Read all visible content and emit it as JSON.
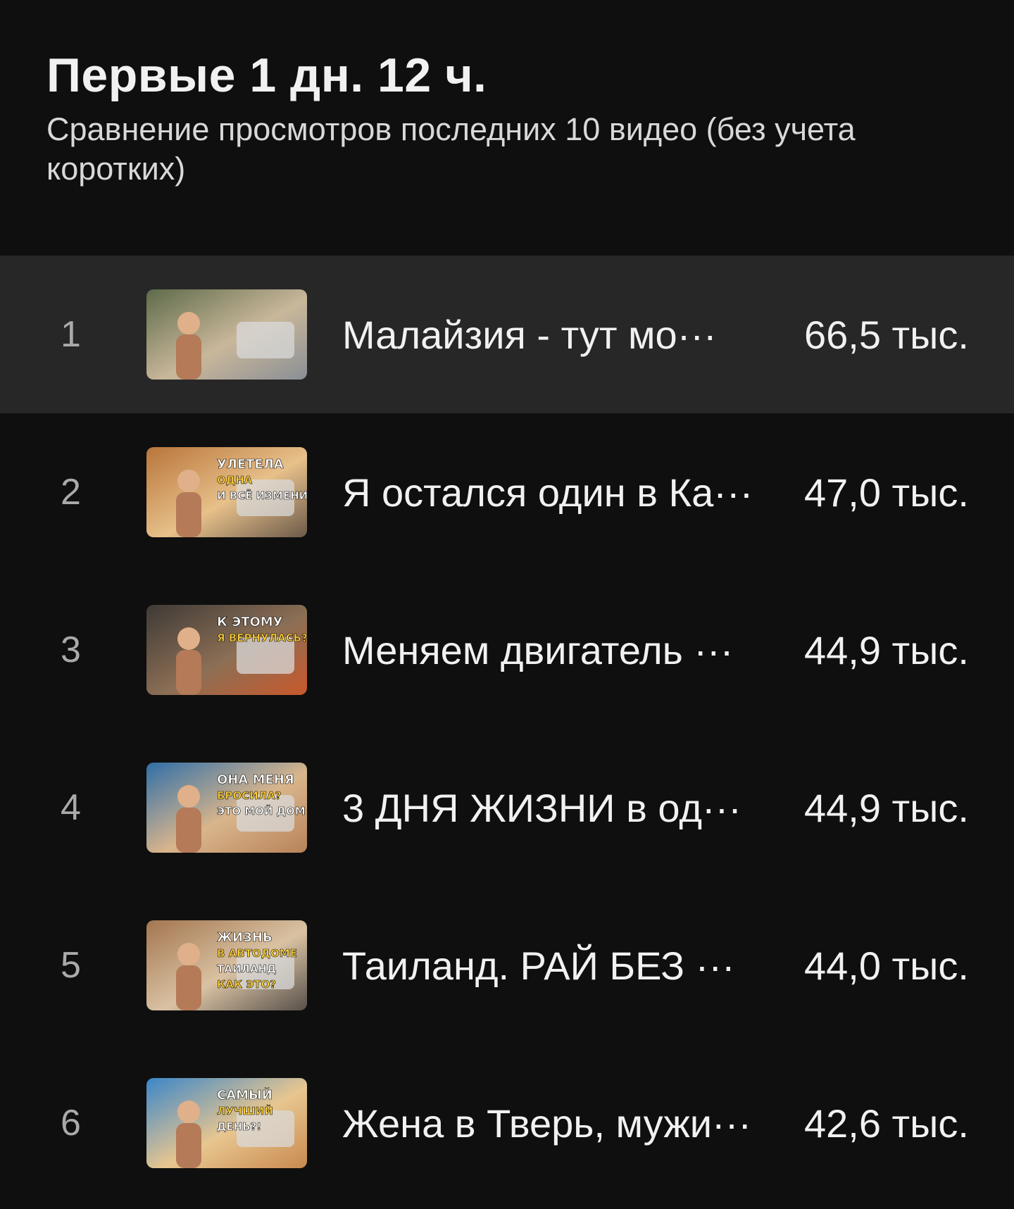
{
  "header": {
    "title": "Первые 1 дн. 12 ч.",
    "subtitle": "Сравнение просмотров последних 10 видео (без учета коротких)"
  },
  "videos": [
    {
      "rank": "1",
      "title": "Малайзия - тут мо···",
      "views": "66,5 тыс.",
      "highlighted": true,
      "thumb": {
        "palette": [
          "#5d6b4a",
          "#c9b79a",
          "#8a8f96"
        ],
        "overlay": []
      }
    },
    {
      "rank": "2",
      "title": "Я остался один в Ка···",
      "views": "47,0 тыс.",
      "highlighted": false,
      "thumb": {
        "palette": [
          "#b8753a",
          "#e7c08a",
          "#6b5a4a"
        ],
        "overlay": [
          "УЛЕТЕЛА",
          "ОДНА",
          "И ВСЁ ИЗМЕНИЛОСЬ"
        ]
      }
    },
    {
      "rank": "3",
      "title": "Меняем двигатель ···",
      "views": "44,9 тыс.",
      "highlighted": false,
      "thumb": {
        "palette": [
          "#3e3a36",
          "#8c6f55",
          "#c9582b"
        ],
        "overlay": [
          "К ЭТОМУ",
          "Я ВЕРНУЛАСЬ?"
        ]
      }
    },
    {
      "rank": "4",
      "title": "3 ДНЯ ЖИЗНИ в од···",
      "views": "44,9 тыс.",
      "highlighted": false,
      "thumb": {
        "palette": [
          "#2f6fa8",
          "#d9b58c",
          "#b88258"
        ],
        "overlay": [
          "ОНА МЕНЯ",
          "БРОСИЛА?",
          "ЭТО МОЙ ДОМ"
        ]
      }
    },
    {
      "rank": "5",
      "title": "Таиланд. РАЙ БЕЗ ···",
      "views": "44,0 тыс.",
      "highlighted": false,
      "thumb": {
        "palette": [
          "#a3764f",
          "#d9c2a3",
          "#57504a"
        ],
        "overlay": [
          "ЖИЗНЬ",
          "В АВТОДОМЕ",
          "ТАИЛАНД",
          "КАК ЭТО?"
        ]
      }
    },
    {
      "rank": "6",
      "title": "Жена в Тверь, мужи···",
      "views": "42,6 тыс.",
      "highlighted": false,
      "thumb": {
        "palette": [
          "#3a86c9",
          "#e8c690",
          "#c8894e"
        ],
        "overlay": [
          "САМЫЙ",
          "ЛУЧШИЙ",
          "ДЕНЬ?!"
        ]
      }
    }
  ]
}
